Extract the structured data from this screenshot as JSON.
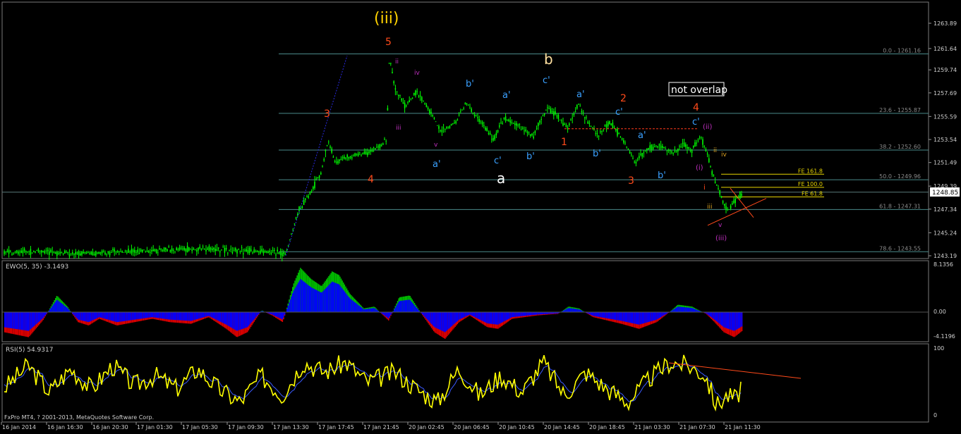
{
  "chart_data": [
    {
      "type": "candlestick",
      "panel": "price",
      "right_axis_ticks": [
        "1263.89",
        "1261.64",
        "1259.74",
        "1257.69",
        "1255.59",
        "1253.54",
        "1251.49",
        "1249.39",
        "1247.34",
        "1245.24",
        "1243.19"
      ],
      "current_price": "1248.85",
      "fib_levels": [
        "0.0 - 1261.16",
        "23.6 - 1255.87",
        "38.2 - 1252.60",
        "50.0 - 1249.96",
        "61.8 - 1247.31",
        "78.6 - 1243.55"
      ],
      "fe_levels": [
        "FE 161.8",
        "FE 100.0",
        "FE 61.8"
      ],
      "notes": [
        "not overlap"
      ],
      "wave_labels": [
        {
          "text": "(iii)",
          "color": "#ffd200"
        },
        {
          "text": "5",
          "color": "#ff4a1a"
        },
        {
          "text": "3",
          "color": "#ff4a1a"
        },
        {
          "text": "4",
          "color": "#ff4a1a"
        },
        {
          "text": "ii",
          "color": "#c030c0"
        },
        {
          "text": "iii",
          "color": "#c030c0"
        },
        {
          "text": "iv",
          "color": "#c030c0"
        },
        {
          "text": "v",
          "color": "#c030c0"
        },
        {
          "text": "a'",
          "color": "#3aa0ff"
        },
        {
          "text": "b'",
          "color": "#3aa0ff"
        },
        {
          "text": "c'",
          "color": "#3aa0ff"
        },
        {
          "text": "a",
          "color": "#ffffff"
        },
        {
          "text": "a'",
          "color": "#3aa0ff"
        },
        {
          "text": "b'",
          "color": "#3aa0ff"
        },
        {
          "text": "c'",
          "color": "#3aa0ff"
        },
        {
          "text": "b",
          "color": "#ffe0a0"
        },
        {
          "text": "a'",
          "color": "#3aa0ff"
        },
        {
          "text": "b'",
          "color": "#3aa0ff"
        },
        {
          "text": "c'",
          "color": "#3aa0ff"
        },
        {
          "text": "1",
          "color": "#ff4a1a"
        },
        {
          "text": "2",
          "color": "#ff4a1a"
        },
        {
          "text": "a'",
          "color": "#3aa0ff"
        },
        {
          "text": "b'",
          "color": "#3aa0ff"
        },
        {
          "text": "c'",
          "color": "#3aa0ff"
        },
        {
          "text": "3",
          "color": "#ff4a1a"
        },
        {
          "text": "4",
          "color": "#ff4a1a"
        },
        {
          "text": "(ii)",
          "color": "#c030c0"
        },
        {
          "text": "(i)",
          "color": "#c030c0"
        },
        {
          "text": "ii",
          "color": "#d9a020"
        },
        {
          "text": "iv",
          "color": "#d9a020"
        },
        {
          "text": "i",
          "color": "#ff4a1a"
        },
        {
          "text": "iii",
          "color": "#d9a020"
        },
        {
          "text": "v",
          "color": "#c030c0"
        },
        {
          "text": "(iii)",
          "color": "#c030c0"
        }
      ],
      "candle_closes": [
        1244.0,
        1244.3,
        1244.1,
        1244.6,
        1244.4,
        1244.0,
        1244.5,
        1244.3,
        1244.7,
        1244.2,
        1244.5,
        1244.1,
        1244.6,
        1244.3,
        1244.0,
        1244.4,
        1244.2,
        1244.6,
        1244.3,
        1244.8,
        1244.5,
        1244.2,
        1244.6,
        1244.4,
        1244.0,
        1244.3,
        1244.5,
        1244.1,
        1244.4,
        1244.2,
        1244.0,
        1244.3,
        1244.5,
        1244.2,
        1244.6,
        1244.4,
        1244.1,
        1244.5,
        1244.7,
        1244.3,
        1244.5,
        1244.2,
        1244.4,
        1244.1,
        1244.3,
        1244.6,
        1244.2,
        1244.0,
        1244.4,
        1244.3,
        1244.1,
        1244.5,
        1244.2,
        1244.4,
        1244.0,
        1244.3,
        1244.1,
        1244.5,
        1244.3,
        1244.2,
        1244.0,
        1244.3,
        1244.2,
        1244.4,
        1244.1,
        1244.0,
        1244.2,
        1244.4,
        1244.1,
        1244.3,
        1244.5,
        1244.2,
        1244.0,
        1244.3,
        1244.2,
        1244.1,
        1244.3,
        1244.4,
        1244.2,
        1244.0,
        1244.3,
        1244.6,
        1244.4,
        1244.2,
        1244.5,
        1244.3,
        1244.1,
        1244.4,
        1244.2,
        1244.5,
        1244.3,
        1244.0,
        1244.4,
        1244.2,
        1244.5,
        1244.3,
        1244.1,
        1244.4,
        1244.3,
        1244.2,
        1244.1,
        1244.4,
        1244.2,
        1244.3,
        1244.0,
        1244.2,
        1244.4,
        1244.3,
        1244.1,
        1244.2,
        1244.0,
        1244.3,
        1244.2,
        1244.1,
        1244.3,
        1244.2,
        1244.0,
        1244.3,
        1244.5,
        1244.2,
        1244.4,
        1244.3,
        1244.1,
        1244.4,
        1244.3,
        1244.2,
        1244.3,
        1244.1,
        1244.4,
        1244.2,
        1244.5,
        1244.3,
        1244.2,
        1244.6,
        1244.4,
        1244.2,
        1244.5,
        1244.3,
        1244.6,
        1244.4,
        1244.2,
        1244.5,
        1244.3,
        1244.1,
        1244.4,
        1244.3,
        1244.5,
        1244.2,
        1244.4,
        1244.1,
        1244.3,
        1244.4,
        1244.2,
        1244.5,
        1244.3,
        1244.1,
        1244.4,
        1244.2,
        1244.3,
        1244.5,
        1244.2,
        1244.4,
        1244.3,
        1244.5,
        1244.2,
        1244.4,
        1244.1,
        1244.3,
        1244.5,
        1244.3,
        1244.2,
        1244.4,
        1244.3,
        1244.1,
        1244.3,
        1244.5,
        1244.2,
        1244.4,
        1244.3,
        1244.5,
        1244.2,
        1244.4,
        1244.6,
        1244.3,
        1244.5,
        1244.2,
        1244.4,
        1244.6,
        1244.3,
        1244.5,
        1244.2,
        1244.4,
        1244.3,
        1244.5,
        1244.2,
        1244.4,
        1244.3,
        1244.5,
        1244.2,
        1244.4,
        1244.6,
        1244.3,
        1244.5,
        1244.7,
        1244.4,
        1244.6,
        1244.3,
        1244.5,
        1244.8,
        1244.6,
        1244.3,
        1244.5,
        1244.7,
        1244.4,
        1244.6,
        1244.3,
        1244.5,
        1244.7,
        1244.4,
        1244.6,
        1244.3,
        1244.5,
        1244.7,
        1244.4,
        1244.6,
        1244.8,
        1244.5,
        1244.7,
        1244.4,
        1244.6,
        1244.8,
        1244.5,
        1244.7,
        1244.4,
        1244.6,
        1244.8,
        1244.5,
        1244.7,
        1244.9,
        1244.6,
        1244.8,
        1244.5,
        1244.7,
        1244.9,
        1244.6,
        1244.8,
        1245.0,
        1244.7,
        1244.9,
        1244.6,
        1244.8,
        1245.0,
        1244.7,
        1244.9,
        1245.1,
        1244.8,
        1245.0,
        1244.7,
        1244.9,
        1245.1,
        1244.8,
        1245.0,
        1245.2,
        1244.9,
        1245.1,
        1244.8,
        1245.0,
        1245.2,
        1244.9,
        1245.1,
        1245.3,
        1245.0,
        1245.2,
        1244.9,
        1245.1,
        1245.3,
        1245.0,
        1245.2,
        1245.4,
        1245.1,
        1245.3,
        1245.0,
        1245.2,
        1245.4,
        1245.1,
        1245.3,
        1245.5,
        1245.2,
        1245.4,
        1245.1,
        1245.3,
        1245.5,
        1245.2,
        1245.4,
        1245.6,
        1245.3,
        1245.5,
        1245.2,
        1245.4,
        1245.6,
        1245.3,
        1245.5,
        1245.7,
        1245.4,
        1245.6,
        1245.3,
        1245.5,
        1245.7,
        1245.4,
        1245.6,
        1245.8,
        1245.5,
        1245.7,
        1245.4,
        1245.6,
        1245.8,
        1245.5,
        1245.7,
        1245.9,
        1245.6,
        1245.8,
        1245.5,
        1245.7,
        1245.9,
        1245.6,
        1245.8,
        1246.0,
        1245.7,
        1245.9,
        1245.6,
        1245.8,
        1246.0,
        1245.7,
        1245.9,
        1246.1,
        1245.8,
        1246.0,
        1245.7,
        1245.9,
        1246.1,
        1245.8,
        1246.0,
        1246.2,
        1245.9,
        1246.1,
        1245.8,
        1246.0,
        1246.2,
        1245.9,
        1246.1,
        1246.3,
        1246.0,
        1246.2,
        1245.9,
        1246.1,
        1246.3,
        1246.0,
        1246.2,
        1246.4,
        1246.1,
        1246.3,
        1246.0,
        1246.2,
        1246.4,
        1246.1,
        1246.3,
        1246.5,
        1246.2,
        1246.4,
        1246.1,
        1246.3,
        1246.5,
        1246.2,
        1246.4,
        1246.6,
        1246.3,
        1246.5,
        1246.2,
        1246.4,
        1246.6,
        1246.3,
        1246.5
      ],
      "colors": {
        "background": "#000000",
        "candle": "#00ff00",
        "grid": "#2a5a5a",
        "fib": "#4a8a8a",
        "fe": "#e6d400",
        "trend": "#ff4a1a"
      }
    },
    {
      "type": "histogram",
      "panel": "ewo",
      "label": "EWO(5, 35) -3.1493",
      "right_axis_ticks": [
        "8.1356",
        "0.00",
        "-4.1196"
      ],
      "colors": {
        "positive": "#00c000",
        "negative": "#e00000",
        "signal": "#0000ff"
      }
    },
    {
      "type": "line",
      "panel": "rsi",
      "label": "RSI(5) 54.9317",
      "right_axis_ticks": [
        "100",
        "0"
      ],
      "colors": {
        "rsi": "#ffff00",
        "signal": "#3a5aff",
        "trend": "#ff4a1a"
      }
    }
  ],
  "x_axis_labels": [
    "16 Jan 2014",
    "16 Jan 16:30",
    "16 Jan 20:30",
    "17 Jan 01:30",
    "17 Jan 05:30",
    "17 Jan 09:30",
    "17 Jan 13:30",
    "17 Jan 17:45",
    "17 Jan 21:45",
    "20 Jan 02:45",
    "20 Jan 06:45",
    "20 Jan 10:45",
    "20 Jan 14:45",
    "20 Jan 18:45",
    "21 Jan 03:30",
    "21 Jan 07:30",
    "21 Jan 11:30"
  ],
  "footer": "FxPro MT4, ? 2001-2013, MetaQuotes Software Corp."
}
